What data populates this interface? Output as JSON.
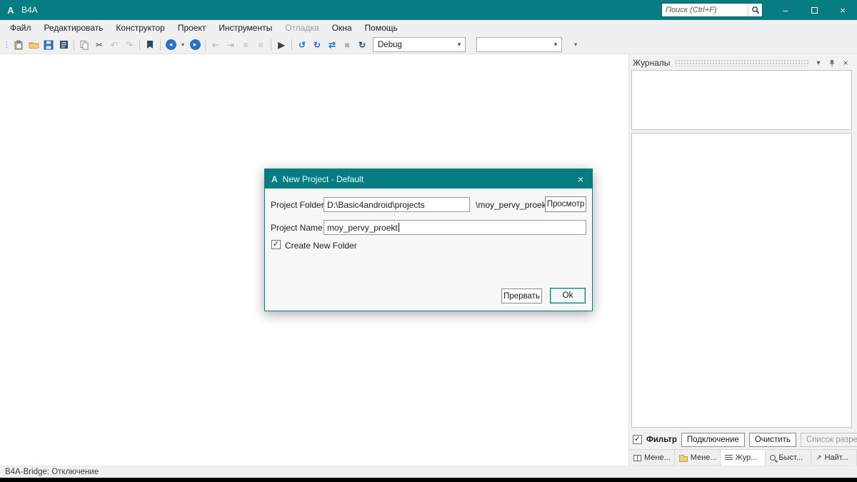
{
  "colors": {
    "accent_teal": "#077c82",
    "folder_yellow": "#f3cd7e",
    "save_blue": "#3a76c4",
    "nav_blue": "#2a70c8",
    "chrome_gray": "#f0f0f0"
  },
  "window": {
    "logo": "A",
    "title": "B4A",
    "search_placeholder": "Поиск (Ctrl+F)"
  },
  "glyphs": {
    "grip": "⋮",
    "cut": "✂",
    "undo": "↶",
    "redo": "↷",
    "back": "◂",
    "forward": "▸",
    "chevron_down": "▾",
    "outdent": "⇤",
    "indent": "⇥",
    "comment": "≡",
    "uncomment": "≡",
    "run": "▶",
    "connect": "↺",
    "compile": "↻",
    "resume": "⇄",
    "stop": "■",
    "clean": "↻",
    "overflow": "▾",
    "minimize": "–",
    "close": "×",
    "check": "✓",
    "find_arrow": "↗"
  },
  "menu": {
    "items": [
      {
        "label": "Файл"
      },
      {
        "label": "Редактировать"
      },
      {
        "label": "Конструктор"
      },
      {
        "label": "Проект"
      },
      {
        "label": "Инструменты"
      },
      {
        "label": "Отладка",
        "disabled": true
      },
      {
        "label": "Окна"
      },
      {
        "label": "Помощь"
      }
    ]
  },
  "toolbar": {
    "debug_dropdown": {
      "value": "Debug"
    },
    "profile_dropdown": {
      "value": ""
    },
    "icon_names": [
      "toolbar-grip",
      "paste-icon",
      "open-folder-icon",
      "save-icon",
      "find-icon",
      "copy-icon",
      "cut-icon",
      "undo-icon",
      "redo-icon",
      "bookmark-icon",
      "back-icon",
      "back-dropdown-icon",
      "forward-icon",
      "outdent-icon",
      "indent-icon",
      "comment-icon",
      "uncomment-icon",
      "run-icon",
      "connect-icon",
      "compile-icon",
      "resume-icon",
      "stop-icon",
      "clean-icon",
      "toolbar-overflow-icon"
    ]
  },
  "dialog": {
    "logo": "A",
    "title": "New Project - Default",
    "project_folder_label": "Project Folder",
    "project_folder_value": "D:\\Basic4android\\projects",
    "folder_suffix": "\\moy_pervy_proekt",
    "browse_label": "Просмотр",
    "project_name_label": "Project Name",
    "project_name_value": "moy_pervy_proekt",
    "create_folder_label": "Create New Folder",
    "create_folder_checked": true,
    "cancel_label": "Прервать",
    "ok_label": "Ok"
  },
  "logs_panel": {
    "title": "Журналы",
    "filter_label": "Фильтр",
    "filter_checked": true,
    "connect_label": "Подключение",
    "clear_label": "Очистить",
    "permissions_label": "Список разрешений",
    "tabs": [
      {
        "label": "Мене..."
      },
      {
        "label": "Мене..."
      },
      {
        "label": "Жур...",
        "active": true
      },
      {
        "label": "Быст..."
      },
      {
        "label": "Найт..."
      }
    ]
  },
  "status_bar": {
    "text": "B4A-Bridge: Отключение"
  }
}
